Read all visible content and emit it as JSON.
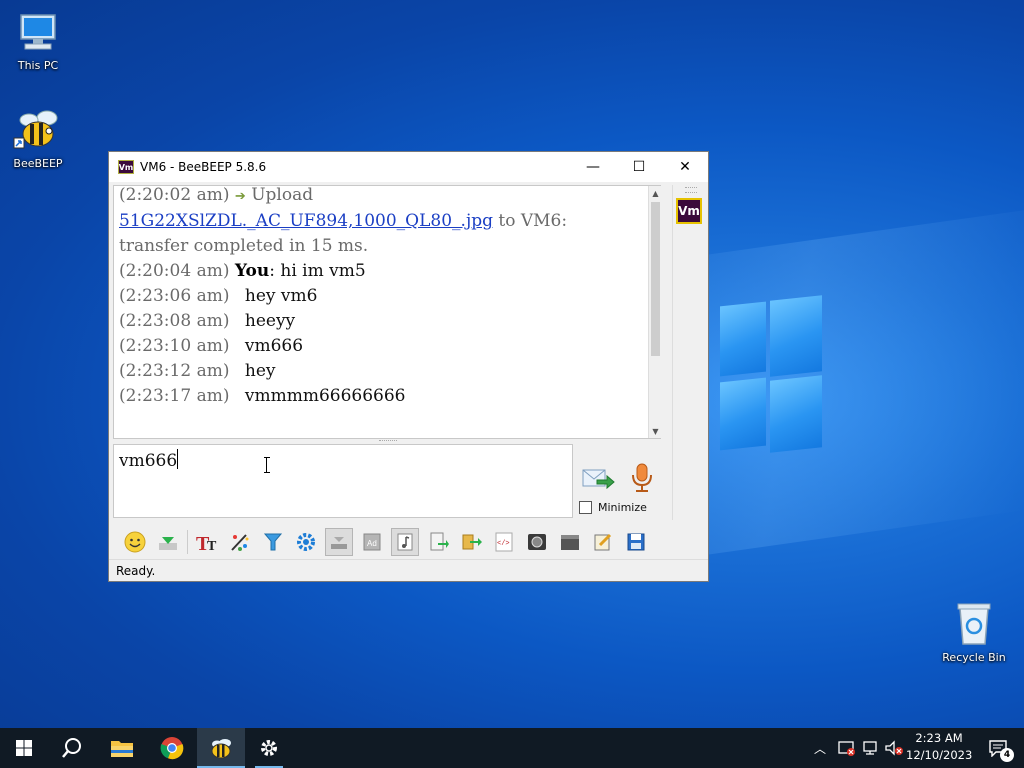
{
  "desktop": {
    "icons": [
      {
        "label": "This PC",
        "icon": "computer-icon"
      },
      {
        "label": "BeeBEEP",
        "icon": "bee-icon"
      },
      {
        "label": "Recycle Bin",
        "icon": "recycle-bin-icon"
      }
    ]
  },
  "window": {
    "title": "VM6 - BeeBEEP 5.8.6",
    "title_icon_text": "Vm",
    "controls": {
      "minimize": "—",
      "maximize": "☐",
      "close": "✕"
    }
  },
  "chat": {
    "upload_time": "(2:20:02 am)",
    "upload_word": "Upload",
    "upload_file": "51G22XSlZDL._AC_UF894,1000_QL80_.jpg",
    "upload_to": " to VM6:",
    "upload_status": "transfer completed in 15 ms.",
    "you_time": "(2:20:04 am)",
    "you_label": "You",
    "you_text": ": hi im vm5",
    "messages": [
      {
        "time": "(2:23:06 am)",
        "text": "hey vm6"
      },
      {
        "time": "(2:23:08 am)",
        "text": "heeyy"
      },
      {
        "time": "(2:23:10 am)",
        "text": "vm666"
      },
      {
        "time": "(2:23:12 am)",
        "text": "hey"
      },
      {
        "time": "(2:23:17 am)",
        "text": "vmmmm66666666"
      }
    ]
  },
  "side_panel": {
    "user_badge": "Vm"
  },
  "input": {
    "value": "vm666"
  },
  "minimize_label": "Minimize",
  "toolbar": {
    "tools": [
      "emoticon-icon",
      "file-send-icon",
      "font-icon",
      "color-icon",
      "filter-icon",
      "settings-icon",
      "compact-view-icon",
      "voice-icon",
      "sound-icon",
      "save-chat-icon",
      "share-icon",
      "code-icon",
      "screenshot-icon",
      "history-icon",
      "clear-icon",
      "save-icon"
    ]
  },
  "status": {
    "text": "Ready."
  },
  "taskbar": {
    "clock_time": "2:23 AM",
    "clock_date": "12/10/2023",
    "notifications_count": "4"
  },
  "colors": {
    "accent": "#76b9ed",
    "link": "#1b3fc4",
    "badge_bg": "#3b0a3b",
    "badge_border": "#e6c200"
  }
}
